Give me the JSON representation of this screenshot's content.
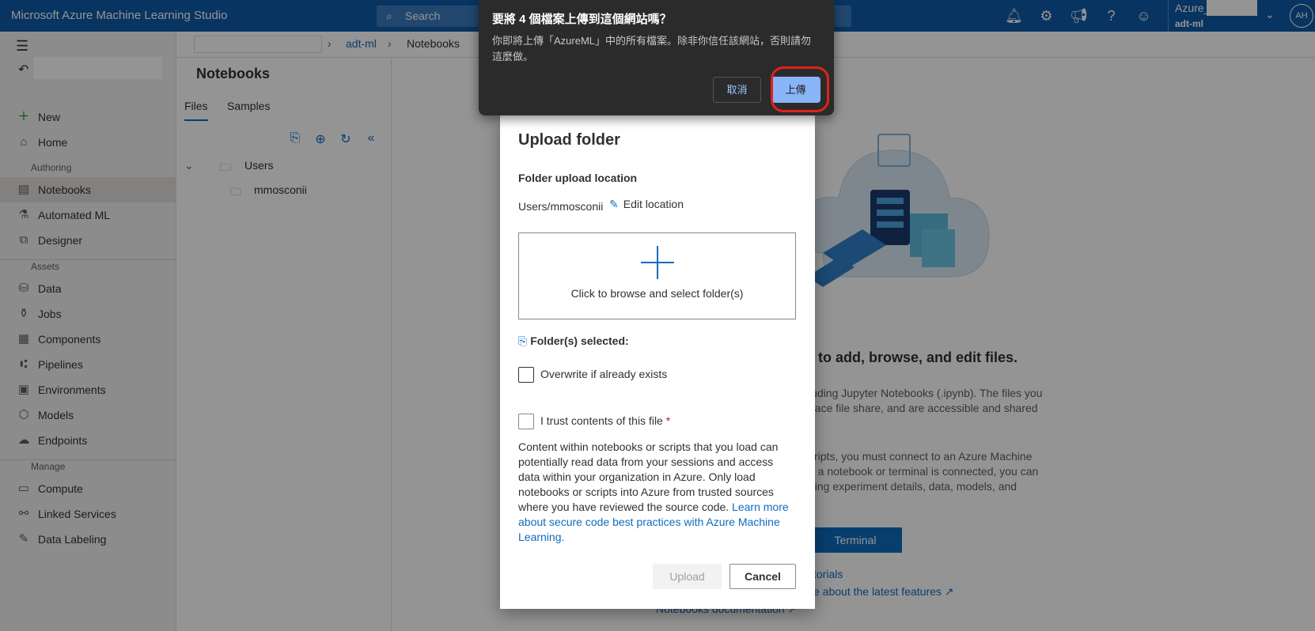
{
  "topbar": {
    "brand": "Microsoft Azure Machine Learning Studio",
    "search_label": "Search",
    "account_line1": "Azure_",
    "account_line2": "adt-ml",
    "avatar_initials": "AH"
  },
  "sidebar": {
    "sections": {
      "authoring": "Authoring",
      "assets": "Assets",
      "manage": "Manage"
    },
    "items": [
      {
        "label": "New",
        "icon": "plus-icon"
      },
      {
        "label": "Home",
        "icon": "home-icon"
      },
      {
        "label": "Notebooks",
        "icon": "notebook-icon"
      },
      {
        "label": "Automated ML",
        "icon": "automl-icon"
      },
      {
        "label": "Designer",
        "icon": "designer-icon"
      },
      {
        "label": "Data",
        "icon": "data-icon"
      },
      {
        "label": "Jobs",
        "icon": "flask-icon"
      },
      {
        "label": "Components",
        "icon": "components-icon"
      },
      {
        "label": "Pipelines",
        "icon": "pipeline-icon"
      },
      {
        "label": "Environments",
        "icon": "environment-icon"
      },
      {
        "label": "Models",
        "icon": "model-icon"
      },
      {
        "label": "Endpoints",
        "icon": "endpoint-icon"
      },
      {
        "label": "Compute",
        "icon": "compute-icon"
      },
      {
        "label": "Linked Services",
        "icon": "link-icon"
      },
      {
        "label": "Data Labeling",
        "icon": "labeling-icon"
      }
    ]
  },
  "breadcrumb": {
    "crumb1": "adt-ml",
    "crumb2": "Notebooks"
  },
  "filepane": {
    "title": "Notebooks",
    "tabs": [
      "Files",
      "Samples"
    ],
    "tree": [
      {
        "label": "Users"
      },
      {
        "label": "mmosconii"
      }
    ]
  },
  "background": {
    "heading": "to add, browse, and edit files.",
    "para1": [
      "luding Jupyter Notebooks (.ipynb). The files you",
      "pace file share, and are accessible and shared"
    ],
    "para2": [
      "cripts, you must connect to an Azure Machine",
      "e a notebook or terminal is connected, you can",
      "ding experiment details, data, models, and"
    ],
    "terminal_button": "Terminal",
    "link1": "torials",
    "link2": "e about the latest features",
    "link3": "Notebooks documentation"
  },
  "upload_dialog": {
    "title": "Upload folder",
    "location_label": "Folder upload location",
    "location_path": "Users/mmosconii",
    "edit_location": "Edit location",
    "dropzone_text": "Click to browse and select folder(s)",
    "selected_label": "Folder(s) selected:",
    "overwrite_label": "Overwrite if already exists",
    "trust_label": "I trust contents of this file",
    "trust_required": "*",
    "body_text": "Content within notebooks or scripts that you load can potentially read data from your sessions and access data within your organization in Azure. Only load notebooks or scripts into Azure from trusted sources where you have reviewed the source code. ",
    "body_link": "Learn more about secure code best practices with Azure Machine Learning.",
    "upload_button": "Upload",
    "cancel_button": "Cancel"
  },
  "browser_prompt": {
    "title": "要將 4 個檔案上傳到這個網站嗎？",
    "message": "你即將上傳「AzureML」中的所有檔案。除非你信任該網站，否則請勿這麼做。",
    "cancel": "取消",
    "confirm": "上傳"
  },
  "colors": {
    "accent": "#0f6cbd",
    "topbar": "#0f5ba7",
    "highlight": "#e0221b"
  }
}
